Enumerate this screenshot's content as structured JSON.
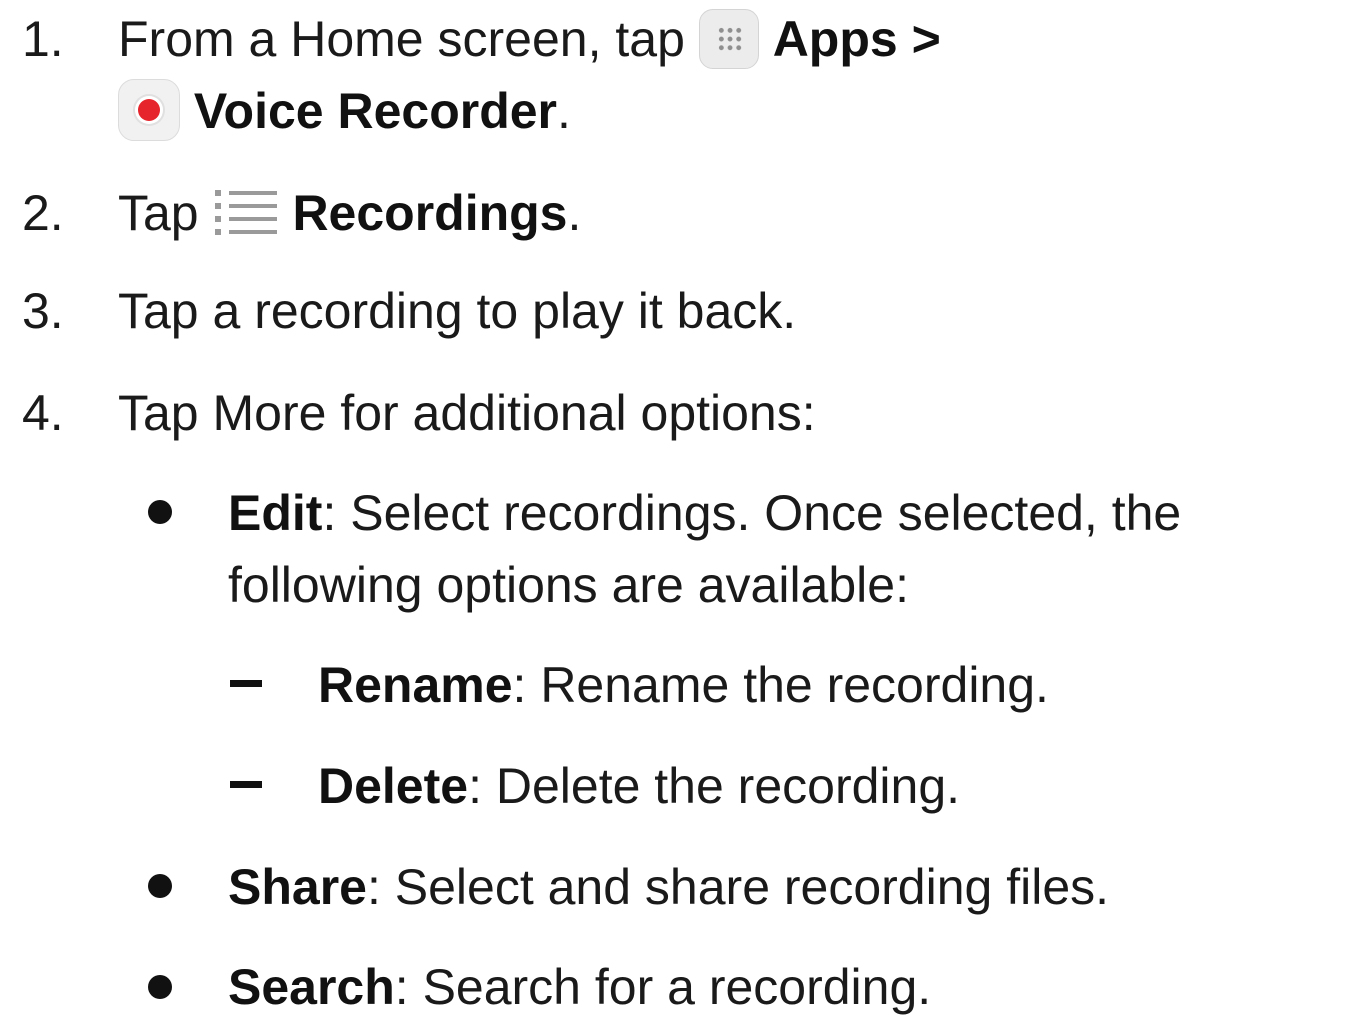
{
  "steps": [
    {
      "number": "1.",
      "line1_pre": "From a Home screen, tap",
      "apps_icon": "apps-grid-icon",
      "apps_label": "Apps",
      "sep": ">",
      "voice_icon": "voice-recorder-icon",
      "voice_label": "Voice Recorder",
      "end": "."
    },
    {
      "number": "2.",
      "pre": "Tap",
      "list_icon": "recordings-list-icon",
      "label": "Recordings",
      "end": "."
    },
    {
      "number": "3.",
      "text": "Tap a recording to play it back."
    },
    {
      "number": "4.",
      "text": "Tap More for additional options:"
    }
  ],
  "options": [
    {
      "label": "Edit",
      "desc_line1": ": Select recordings. Once selected, the",
      "desc_line2": "following options are available:",
      "sub": [
        {
          "label": "Rename",
          "desc": ": Rename the recording."
        },
        {
          "label": "Delete",
          "desc": ": Delete the recording."
        }
      ]
    },
    {
      "label": "Share",
      "desc": ": Select and share recording files."
    },
    {
      "label": "Search",
      "desc": ": Search for a recording."
    }
  ],
  "colors": {
    "text": "#1a1a1a",
    "record_red": "#e5242b",
    "icon_gray": "#8f8f8f"
  }
}
